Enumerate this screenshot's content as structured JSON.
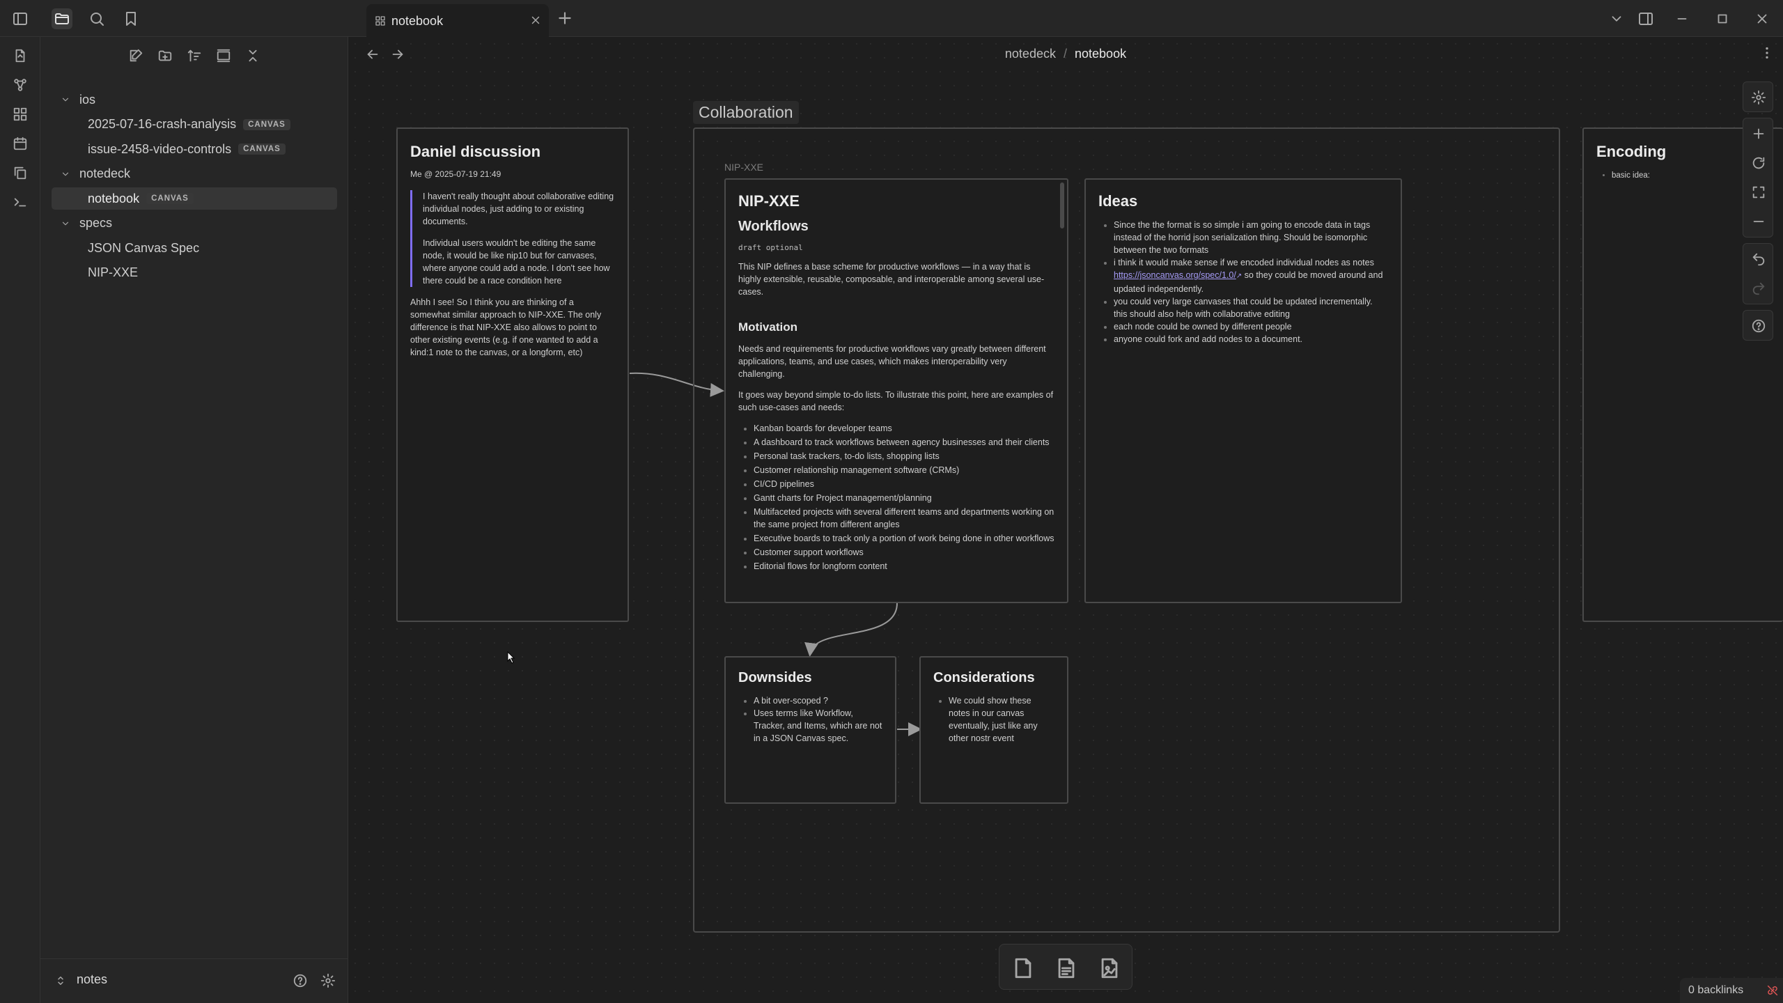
{
  "tab": {
    "title": "notebook"
  },
  "breadcrumb": {
    "parent": "notedeck",
    "separator": "/",
    "current": "notebook"
  },
  "sidebar": {
    "tree": [
      {
        "type": "folder",
        "label": "ios"
      },
      {
        "type": "file",
        "label": "2025-07-16-crash-analysis",
        "badge": "CANVAS"
      },
      {
        "type": "file",
        "label": "issue-2458-video-controls",
        "badge": "CANVAS"
      },
      {
        "type": "folder",
        "label": "notedeck"
      },
      {
        "type": "file",
        "label": "notebook",
        "badge": "CANVAS",
        "selected": true
      },
      {
        "type": "folder",
        "label": "specs"
      },
      {
        "type": "file",
        "label": "JSON Canvas Spec"
      },
      {
        "type": "file",
        "label": "NIP-XXE"
      }
    ],
    "vault_name": "notes"
  },
  "canvas": {
    "group_label": "Collaboration",
    "daniel": {
      "title": "Daniel discussion",
      "meta": "Me @ 2025-07-19 21:49",
      "quote1": "I haven't really thought about collaborative editing individual nodes, just adding to or existing documents.",
      "quote2": "Individual users wouldn't be editing the same node, it would be like nip10 but for canvases, where anyone could add a node. I don't see how there could be a race condition here",
      "reply": "Ahhh I see! So I think you are thinking of a somewhat similar approach to NIP-XXE. The only difference is that NIP-XXE also allows to point to other existing events (e.g. if one wanted to add a kind:1 note to the canvas, or a longform, etc)"
    },
    "nip": {
      "file_label": "NIP-XXE",
      "title": "NIP-XXE",
      "subtitle": "Workflows",
      "tags": "draft optional",
      "intro": "This NIP defines a base scheme for productive workflows — in a way that is highly extensible, reusable, composable, and interoperable among several use-cases.",
      "motivation_title": "Motivation",
      "motivation1": "Needs and requirements for productive workflows vary greatly between different applications, teams, and use cases, which makes interoperability very challenging.",
      "motivation2": "It goes way beyond simple to-do lists. To illustrate this point, here are examples of such use-cases and needs:",
      "items": [
        "Kanban boards for developer teams",
        "A dashboard to track workflows between agency businesses and their clients",
        "Personal task trackers, to-do lists, shopping lists",
        "Customer relationship management software (CRMs)",
        "CI/CD pipelines",
        "Gantt charts for Project management/planning",
        "Multifaceted projects with several different teams and departments working on the same project from different angles",
        "Executive boards to track only a portion of work being done in other workflows",
        "Customer support workflows",
        "Editorial flows for longform content"
      ]
    },
    "ideas": {
      "title": "Ideas",
      "item1": "Since the the format is so simple i am going to encode data in tags instead of the horrid json serialization thing. Should be isomorphic between the two formats",
      "item2_pre": "i think it would make sense if we encoded individual nodes as notes ",
      "item2_link": "https://jsoncanvas.org/spec/1.0/",
      "item2_post": " so they could be moved around and updated independently.",
      "item3": "you could very large canvases that could be updated incrementally. this should also help with collaborative editing",
      "item4": "each node could be owned by different people",
      "item5": "anyone could fork and add nodes to a document."
    },
    "downsides": {
      "title": "Downsides",
      "items": [
        "A bit over-scoped ?",
        "Uses terms like Workflow, Tracker, and Items, which are not in a JSON Canvas spec."
      ]
    },
    "considerations": {
      "title": "Considerations",
      "items": [
        "We could show these notes in our canvas eventually, just like any other nostr event"
      ]
    },
    "encoding": {
      "title": "Encoding",
      "items": [
        "basic idea:"
      ]
    }
  },
  "status": {
    "backlinks": "0 backlinks"
  },
  "colors": {
    "accent": "#7f6df2",
    "link": "#a59bf5",
    "background": "#1e1e1e",
    "panel": "#262626"
  }
}
